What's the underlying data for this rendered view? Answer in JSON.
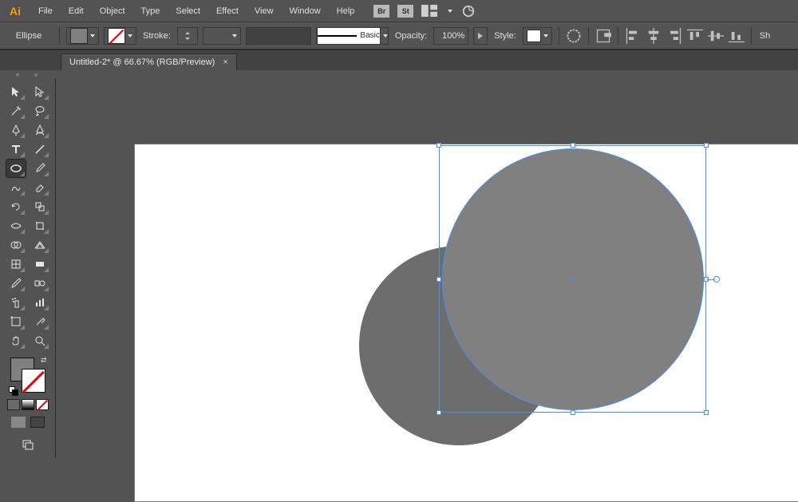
{
  "menu": {
    "items": [
      "File",
      "Edit",
      "Object",
      "Type",
      "Select",
      "Effect",
      "View",
      "Window",
      "Help"
    ],
    "badges": {
      "bridge": "Br",
      "stock": "St"
    }
  },
  "control": {
    "shape_name": "Ellipse",
    "stroke_label": "Stroke:",
    "stroke_style_label": "Basic",
    "opacity_label": "Opacity:",
    "opacity_value": "100%",
    "style_label": "Style:",
    "truncated_right": "Sh"
  },
  "tab": {
    "title": "Untitled-2* @ 66.67% (RGB/Preview)",
    "close": "×"
  },
  "tools": {
    "items": [
      [
        "selection",
        "direct-selection"
      ],
      [
        "magic-wand",
        "lasso"
      ],
      [
        "pen",
        "curvature"
      ],
      [
        "type",
        "line-segment"
      ],
      [
        "ellipse",
        "paintbrush"
      ],
      [
        "shaper",
        "eraser"
      ],
      [
        "rotate",
        "scale"
      ],
      [
        "width",
        "free-transform"
      ],
      [
        "shape-builder",
        "perspective-grid"
      ],
      [
        "mesh",
        "gradient"
      ],
      [
        "eyedropper",
        "blend"
      ],
      [
        "symbol-sprayer",
        "column-graph"
      ],
      [
        "artboard",
        "slice"
      ],
      [
        "hand",
        "zoom"
      ]
    ],
    "selected": "ellipse"
  },
  "colors": {
    "fill": "#808080",
    "stroke": "none",
    "accent": "#ff9a00",
    "selection": "#4a90e2"
  },
  "canvas": {
    "shape_back_fill": "#6d6d6d",
    "shape_front_fill": "#808080"
  }
}
